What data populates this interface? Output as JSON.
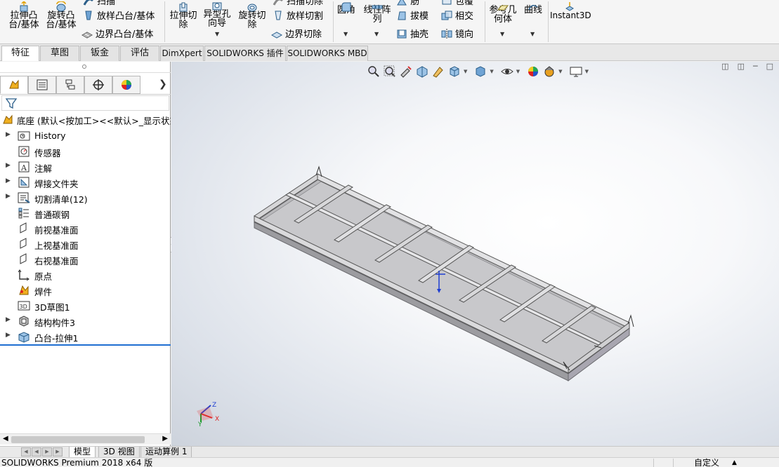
{
  "ribbon": {
    "extrude_boss": "拉伸凸\n台/基体",
    "revolve_boss": "旋转凸\n台/基体",
    "sweep_boss": "扫描",
    "loft_boss": "放样凸台/基体",
    "boundary_boss": "边界凸台/基体",
    "extrude_cut": "拉伸切\n除",
    "hole_wizard": "异型孔\n向导",
    "revolve_cut": "旋转切\n除",
    "sweep_cut": "扫描切除",
    "loft_cut": "放样切割",
    "boundary_cut": "边界切除",
    "fillet": "圆角",
    "linear_pattern": "线性阵\n列",
    "rib": "筋",
    "draft": "拔模",
    "shell": "抽壳",
    "wrap": "包覆",
    "intersect": "相交",
    "mirror": "镜向",
    "ref_geometry": "参考几\n何体",
    "curves": "曲线",
    "instant3d": "Instant3D"
  },
  "tabs": [
    {
      "label": "特征",
      "active": true
    },
    {
      "label": "草图"
    },
    {
      "label": "钣金"
    },
    {
      "label": "评估"
    },
    {
      "label": "DimXpert"
    },
    {
      "label": "SOLIDWORKS 插件"
    },
    {
      "label": "SOLIDWORKS MBD"
    }
  ],
  "feature_manager": {
    "root_label": "底座 (默认<按加工><<默认>_显示状态",
    "items": [
      {
        "label": "History",
        "expandable": true,
        "icon": "history-folder-icon"
      },
      {
        "label": "传感器",
        "expandable": false,
        "icon": "sensor-icon"
      },
      {
        "label": "注解",
        "expandable": true,
        "icon": "annotation-icon"
      },
      {
        "label": "焊接文件夹",
        "expandable": true,
        "icon": "weldment-folder-icon"
      },
      {
        "label": "切割清单(12)",
        "expandable": true,
        "icon": "cut-list-icon"
      },
      {
        "label": "普通碳钢",
        "expandable": false,
        "icon": "material-icon"
      },
      {
        "label": "前视基准面",
        "expandable": false,
        "icon": "plane-icon"
      },
      {
        "label": "上视基准面",
        "expandable": false,
        "icon": "plane-icon"
      },
      {
        "label": "右视基准面",
        "expandable": false,
        "icon": "plane-icon"
      },
      {
        "label": "原点",
        "expandable": false,
        "icon": "origin-icon"
      },
      {
        "label": "焊件",
        "expandable": false,
        "icon": "weldment-icon"
      },
      {
        "label": "3D草图1",
        "expandable": false,
        "icon": "3d-sketch-icon"
      },
      {
        "label": "结构构件3",
        "expandable": true,
        "icon": "structural-member-icon"
      },
      {
        "label": "凸台-拉伸1",
        "expandable": true,
        "icon": "boss-extrude-icon"
      }
    ]
  },
  "bottom_tabs": [
    {
      "label": "模型",
      "active": true
    },
    {
      "label": "3D 视图"
    },
    {
      "label": "运动算例 1"
    }
  ],
  "status": {
    "left": "SOLIDWORKS Premium 2018 x64 版",
    "right": "自定义"
  },
  "triad": {
    "z": "Z",
    "y": "Y",
    "x": "X"
  },
  "colors": {
    "accent_blue": "#1f6fd1",
    "model_gray": "#c9c9cb",
    "viewport_bg": "#dde2ea"
  }
}
